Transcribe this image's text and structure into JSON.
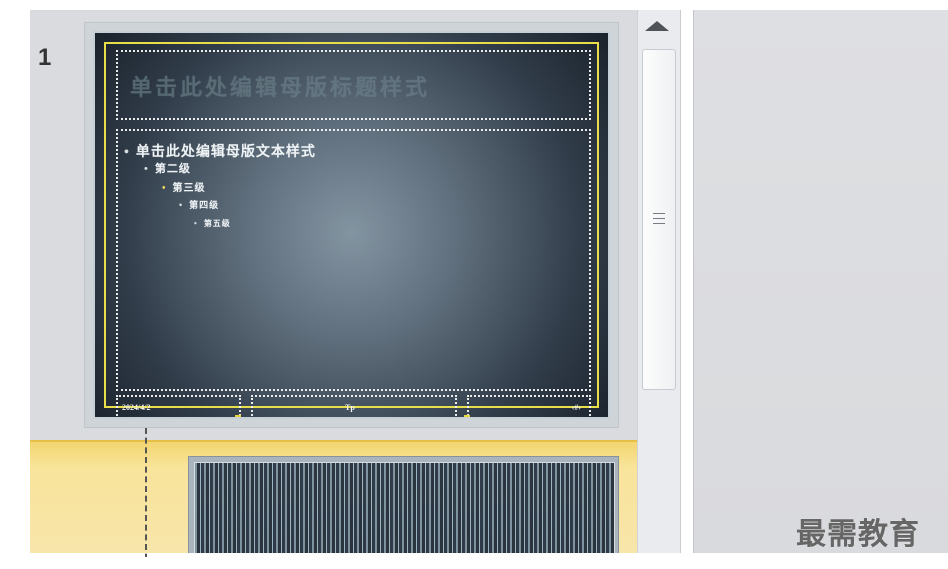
{
  "slides": [
    {
      "number": "1",
      "title": "单击此处编辑母版标题样式",
      "body": [
        "单击此处编辑母版文本样式",
        "第二级",
        "第三级",
        "第四级",
        "第五级"
      ],
      "footer": {
        "left": "2024/4/2",
        "center": "Tp",
        "right": "‹#›"
      }
    },
    {
      "number": ""
    }
  ],
  "watermark": "最需教育",
  "colors": {
    "thumbnail_pane": "#d9dbde",
    "selected_slide": "#f8e49a",
    "slide_background": "#394756",
    "slide_border": "#e8de49",
    "editor_background": "#dcdddf",
    "scroll_arrow": "#4f5358"
  },
  "icons": {
    "scroll_up": "triangle-up-icon",
    "scroll_grip": "scroll-grip-icon"
  }
}
